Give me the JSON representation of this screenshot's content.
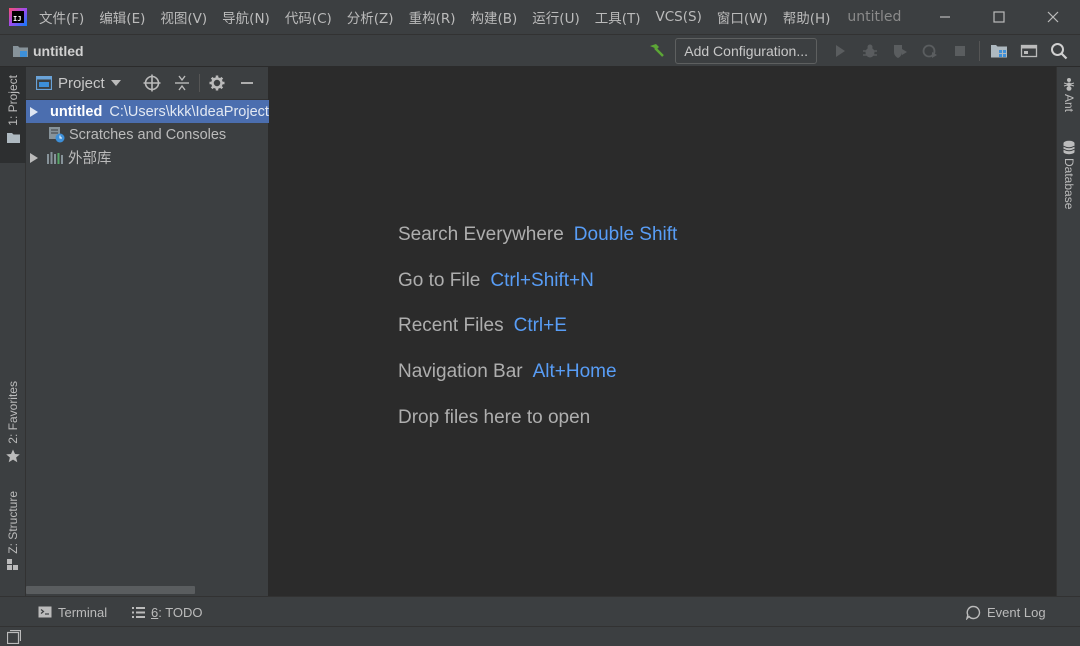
{
  "app": {
    "logo_text": "IJ",
    "window_title": "untitled"
  },
  "menu": [
    "文件(F)",
    "编辑(E)",
    "视图(V)",
    "导航(N)",
    "代码(C)",
    "分析(Z)",
    "重构(R)",
    "构建(B)",
    "运行(U)",
    "工具(T)",
    "VCS(S)",
    "窗口(W)",
    "帮助(H)"
  ],
  "navbar": {
    "breadcrumb": "untitled",
    "add_configuration": "Add Configuration..."
  },
  "left_stripe": {
    "project": "1: Project",
    "favorites": "2: Favorites",
    "structure": "Z: Structure"
  },
  "right_stripe": {
    "ant": "Ant",
    "database": "Database"
  },
  "project_panel": {
    "title": "Project",
    "tree": [
      {
        "label": "untitled",
        "path": "C:\\Users\\kkk\\IdeaProjects\\untitled",
        "expanded": false,
        "selected": true
      },
      {
        "label": "Scratches and Consoles"
      },
      {
        "label": "外部库",
        "expanded": false
      }
    ]
  },
  "editor": {
    "hints": [
      {
        "text": "Search Everywhere",
        "shortcut": "Double Shift"
      },
      {
        "text": "Go to File",
        "shortcut": "Ctrl+Shift+N"
      },
      {
        "text": "Recent Files",
        "shortcut": "Ctrl+E"
      },
      {
        "text": "Navigation Bar",
        "shortcut": "Alt+Home"
      }
    ],
    "drop_hint": "Drop files here to open"
  },
  "bottom_bar": {
    "terminal": "Terminal",
    "todo_num": "6",
    "todo_rest": ": TODO",
    "event_log": "Event Log"
  },
  "colors": {
    "editor_bg": "#2b2b2b",
    "panel_bg": "#3c3f41",
    "selection": "#4b6eaf",
    "shortcut": "#589df6",
    "build_hammer": "#5ca636"
  }
}
